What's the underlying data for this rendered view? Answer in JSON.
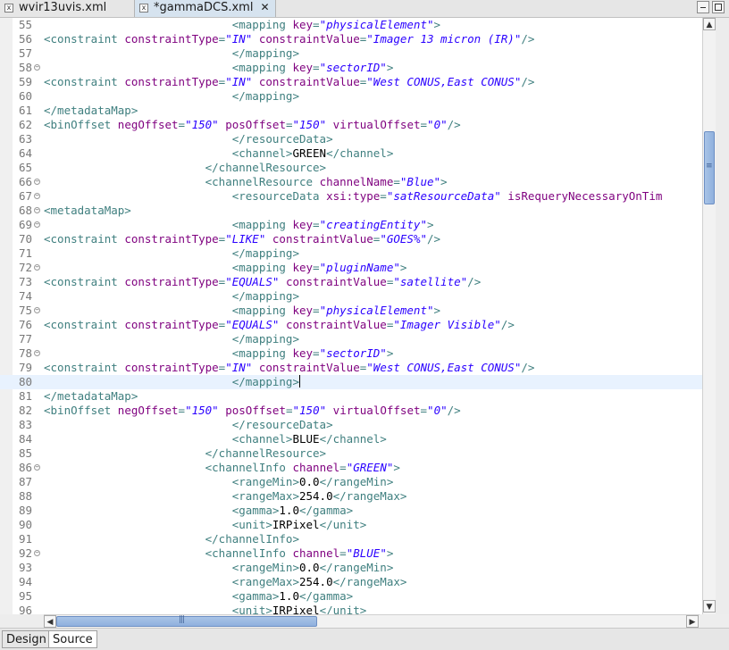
{
  "tabs": [
    {
      "label": "wvir13uvis.xml",
      "active": false
    },
    {
      "label": "*gammaDCS.xml",
      "active": true
    }
  ],
  "bottom_tabs": [
    {
      "label": "Design",
      "active": false
    },
    {
      "label": "Source",
      "active": true
    }
  ],
  "icons": {
    "file": "xml-file-icon",
    "close": "close-icon",
    "minimize": "minimize-icon",
    "maximize": "maximize-icon",
    "fold": "fold-toggle-icon"
  },
  "colors": {
    "tag": "#3f7f7f",
    "attribute": "#7f007f",
    "value": "#2a00ff",
    "text": "#000000",
    "current_line": "#e8f2fe",
    "line_number": "#787878"
  },
  "lines": [
    {
      "n": "55",
      "indent": 28,
      "fold": false,
      "s": [
        [
          "t",
          "<mapping "
        ],
        [
          "a",
          "key"
        ],
        [
          "t",
          "="
        ],
        [
          "v",
          "\"physicalElement\""
        ],
        [
          "t",
          ">"
        ]
      ]
    },
    {
      "n": "56",
      "indent": 0,
      "fold": false,
      "s": [
        [
          "t",
          "<constraint "
        ],
        [
          "a",
          "constraintType"
        ],
        [
          "t",
          "="
        ],
        [
          "v",
          "\"IN\""
        ],
        [
          "t",
          " "
        ],
        [
          "a",
          "constraintValue"
        ],
        [
          "t",
          "="
        ],
        [
          "v",
          "\"Imager 13 micron (IR)\""
        ],
        [
          "t",
          "/>"
        ]
      ]
    },
    {
      "n": "57",
      "indent": 28,
      "fold": false,
      "s": [
        [
          "t",
          "</mapping>"
        ]
      ]
    },
    {
      "n": "58",
      "indent": 28,
      "fold": true,
      "s": [
        [
          "t",
          "<mapping "
        ],
        [
          "a",
          "key"
        ],
        [
          "t",
          "="
        ],
        [
          "v",
          "\"sectorID\""
        ],
        [
          "t",
          ">"
        ]
      ]
    },
    {
      "n": "59",
      "indent": 0,
      "fold": false,
      "s": [
        [
          "t",
          "<constraint "
        ],
        [
          "a",
          "constraintType"
        ],
        [
          "t",
          "="
        ],
        [
          "v",
          "\"IN\""
        ],
        [
          "t",
          " "
        ],
        [
          "a",
          "constraintValue"
        ],
        [
          "t",
          "="
        ],
        [
          "v",
          "\"West CONUS,East CONUS\""
        ],
        [
          "t",
          "/>"
        ]
      ]
    },
    {
      "n": "60",
      "indent": 28,
      "fold": false,
      "s": [
        [
          "t",
          "</mapping>"
        ]
      ]
    },
    {
      "n": "61",
      "indent": 0,
      "fold": false,
      "s": [
        [
          "t",
          "</metadataMap>"
        ]
      ]
    },
    {
      "n": "62",
      "indent": 0,
      "fold": false,
      "s": [
        [
          "t",
          "<binOffset "
        ],
        [
          "a",
          "negOffset"
        ],
        [
          "t",
          "="
        ],
        [
          "v",
          "\"150\""
        ],
        [
          "t",
          " "
        ],
        [
          "a",
          "posOffset"
        ],
        [
          "t",
          "="
        ],
        [
          "v",
          "\"150\""
        ],
        [
          "t",
          " "
        ],
        [
          "a",
          "virtualOffset"
        ],
        [
          "t",
          "="
        ],
        [
          "v",
          "\"0\""
        ],
        [
          "t",
          "/>"
        ]
      ]
    },
    {
      "n": "63",
      "indent": 28,
      "fold": false,
      "s": [
        [
          "t",
          "</resourceData>"
        ]
      ]
    },
    {
      "n": "64",
      "indent": 28,
      "fold": false,
      "s": [
        [
          "t",
          "<channel>"
        ],
        [
          "x",
          "GREEN"
        ],
        [
          "t",
          "</channel>"
        ]
      ]
    },
    {
      "n": "65",
      "indent": 24,
      "fold": false,
      "s": [
        [
          "t",
          "</channelResource>"
        ]
      ]
    },
    {
      "n": "66",
      "indent": 24,
      "fold": true,
      "s": [
        [
          "t",
          "<channelResource "
        ],
        [
          "a",
          "channelName"
        ],
        [
          "t",
          "="
        ],
        [
          "v",
          "\"Blue\""
        ],
        [
          "t",
          ">"
        ]
      ]
    },
    {
      "n": "67",
      "indent": 28,
      "fold": true,
      "s": [
        [
          "t",
          "<resourceData "
        ],
        [
          "a",
          "xsi:type"
        ],
        [
          "t",
          "="
        ],
        [
          "v",
          "\"satResourceData\""
        ],
        [
          "t",
          " "
        ],
        [
          "a",
          "isRequeryNecessaryOnTim"
        ]
      ]
    },
    {
      "n": "68",
      "indent": 0,
      "fold": true,
      "s": [
        [
          "t",
          "<metadataMap>"
        ]
      ]
    },
    {
      "n": "69",
      "indent": 28,
      "fold": true,
      "s": [
        [
          "t",
          "<mapping "
        ],
        [
          "a",
          "key"
        ],
        [
          "t",
          "="
        ],
        [
          "v",
          "\"creatingEntity\""
        ],
        [
          "t",
          ">"
        ]
      ]
    },
    {
      "n": "70",
      "indent": 0,
      "fold": false,
      "s": [
        [
          "t",
          "<constraint "
        ],
        [
          "a",
          "constraintType"
        ],
        [
          "t",
          "="
        ],
        [
          "v",
          "\"LIKE\""
        ],
        [
          "t",
          " "
        ],
        [
          "a",
          "constraintValue"
        ],
        [
          "t",
          "="
        ],
        [
          "v",
          "\"GOES%\""
        ],
        [
          "t",
          "/>"
        ]
      ]
    },
    {
      "n": "71",
      "indent": 28,
      "fold": false,
      "s": [
        [
          "t",
          "</mapping>"
        ]
      ]
    },
    {
      "n": "72",
      "indent": 28,
      "fold": true,
      "s": [
        [
          "t",
          "<mapping "
        ],
        [
          "a",
          "key"
        ],
        [
          "t",
          "="
        ],
        [
          "v",
          "\"pluginName\""
        ],
        [
          "t",
          ">"
        ]
      ]
    },
    {
      "n": "73",
      "indent": 0,
      "fold": false,
      "s": [
        [
          "t",
          "<constraint "
        ],
        [
          "a",
          "constraintType"
        ],
        [
          "t",
          "="
        ],
        [
          "v",
          "\"EQUALS\""
        ],
        [
          "t",
          " "
        ],
        [
          "a",
          "constraintValue"
        ],
        [
          "t",
          "="
        ],
        [
          "v",
          "\"satellite\""
        ],
        [
          "t",
          "/>"
        ]
      ]
    },
    {
      "n": "74",
      "indent": 28,
      "fold": false,
      "s": [
        [
          "t",
          "</mapping>"
        ]
      ]
    },
    {
      "n": "75",
      "indent": 28,
      "fold": true,
      "s": [
        [
          "t",
          "<mapping "
        ],
        [
          "a",
          "key"
        ],
        [
          "t",
          "="
        ],
        [
          "v",
          "\"physicalElement\""
        ],
        [
          "t",
          ">"
        ]
      ]
    },
    {
      "n": "76",
      "indent": 0,
      "fold": false,
      "s": [
        [
          "t",
          "<constraint "
        ],
        [
          "a",
          "constraintType"
        ],
        [
          "t",
          "="
        ],
        [
          "v",
          "\"EQUALS\""
        ],
        [
          "t",
          " "
        ],
        [
          "a",
          "constraintValue"
        ],
        [
          "t",
          "="
        ],
        [
          "v",
          "\"Imager Visible\""
        ],
        [
          "t",
          "/>"
        ]
      ]
    },
    {
      "n": "77",
      "indent": 28,
      "fold": false,
      "s": [
        [
          "t",
          "</mapping>"
        ]
      ]
    },
    {
      "n": "78",
      "indent": 28,
      "fold": true,
      "s": [
        [
          "t",
          "<mapping "
        ],
        [
          "a",
          "key"
        ],
        [
          "t",
          "="
        ],
        [
          "v",
          "\"sectorID\""
        ],
        [
          "t",
          ">"
        ]
      ]
    },
    {
      "n": "79",
      "indent": 0,
      "fold": false,
      "s": [
        [
          "t",
          "<constraint "
        ],
        [
          "a",
          "constraintType"
        ],
        [
          "t",
          "="
        ],
        [
          "v",
          "\"IN\""
        ],
        [
          "t",
          " "
        ],
        [
          "a",
          "constraintValue"
        ],
        [
          "t",
          "="
        ],
        [
          "v",
          "\"West CONUS,East CONUS\""
        ],
        [
          "t",
          "/>"
        ]
      ]
    },
    {
      "n": "80",
      "indent": 28,
      "fold": false,
      "current": true,
      "s": [
        [
          "t",
          "</mapping>"
        ],
        [
          "c",
          ""
        ]
      ]
    },
    {
      "n": "81",
      "indent": 0,
      "fold": false,
      "s": [
        [
          "t",
          "</metadataMap>"
        ]
      ]
    },
    {
      "n": "82",
      "indent": 0,
      "fold": false,
      "s": [
        [
          "t",
          "<binOffset "
        ],
        [
          "a",
          "negOffset"
        ],
        [
          "t",
          "="
        ],
        [
          "v",
          "\"150\""
        ],
        [
          "t",
          " "
        ],
        [
          "a",
          "posOffset"
        ],
        [
          "t",
          "="
        ],
        [
          "v",
          "\"150\""
        ],
        [
          "t",
          " "
        ],
        [
          "a",
          "virtualOffset"
        ],
        [
          "t",
          "="
        ],
        [
          "v",
          "\"0\""
        ],
        [
          "t",
          "/>"
        ]
      ]
    },
    {
      "n": "83",
      "indent": 28,
      "fold": false,
      "s": [
        [
          "t",
          "</resourceData>"
        ]
      ]
    },
    {
      "n": "84",
      "indent": 28,
      "fold": false,
      "s": [
        [
          "t",
          "<channel>"
        ],
        [
          "x",
          "BLUE"
        ],
        [
          "t",
          "</channel>"
        ]
      ]
    },
    {
      "n": "85",
      "indent": 24,
      "fold": false,
      "s": [
        [
          "t",
          "</channelResource>"
        ]
      ]
    },
    {
      "n": "86",
      "indent": 24,
      "fold": true,
      "s": [
        [
          "t",
          "<channelInfo "
        ],
        [
          "a",
          "channel"
        ],
        [
          "t",
          "="
        ],
        [
          "v",
          "\"GREEN\""
        ],
        [
          "t",
          ">"
        ]
      ]
    },
    {
      "n": "87",
      "indent": 28,
      "fold": false,
      "s": [
        [
          "t",
          "<rangeMin>"
        ],
        [
          "x",
          "0.0"
        ],
        [
          "t",
          "</rangeMin>"
        ]
      ]
    },
    {
      "n": "88",
      "indent": 28,
      "fold": false,
      "s": [
        [
          "t",
          "<rangeMax>"
        ],
        [
          "x",
          "254.0"
        ],
        [
          "t",
          "</rangeMax>"
        ]
      ]
    },
    {
      "n": "89",
      "indent": 28,
      "fold": false,
      "s": [
        [
          "t",
          "<gamma>"
        ],
        [
          "x",
          "1.0"
        ],
        [
          "t",
          "</gamma>"
        ]
      ]
    },
    {
      "n": "90",
      "indent": 28,
      "fold": false,
      "s": [
        [
          "t",
          "<unit>"
        ],
        [
          "x",
          "IRPixel"
        ],
        [
          "t",
          "</unit>"
        ]
      ]
    },
    {
      "n": "91",
      "indent": 24,
      "fold": false,
      "s": [
        [
          "t",
          "</channelInfo>"
        ]
      ]
    },
    {
      "n": "92",
      "indent": 24,
      "fold": true,
      "s": [
        [
          "t",
          "<channelInfo "
        ],
        [
          "a",
          "channel"
        ],
        [
          "t",
          "="
        ],
        [
          "v",
          "\"BLUE\""
        ],
        [
          "t",
          ">"
        ]
      ]
    },
    {
      "n": "93",
      "indent": 28,
      "fold": false,
      "s": [
        [
          "t",
          "<rangeMin>"
        ],
        [
          "x",
          "0.0"
        ],
        [
          "t",
          "</rangeMin>"
        ]
      ]
    },
    {
      "n": "94",
      "indent": 28,
      "fold": false,
      "s": [
        [
          "t",
          "<rangeMax>"
        ],
        [
          "x",
          "254.0"
        ],
        [
          "t",
          "</rangeMax>"
        ]
      ]
    },
    {
      "n": "95",
      "indent": 28,
      "fold": false,
      "s": [
        [
          "t",
          "<gamma>"
        ],
        [
          "x",
          "1.0"
        ],
        [
          "t",
          "</gamma>"
        ]
      ]
    },
    {
      "n": "96",
      "indent": 28,
      "fold": false,
      "s": [
        [
          "t",
          "<unit>"
        ],
        [
          "x",
          "IRPixel"
        ],
        [
          "t",
          "</unit>"
        ]
      ]
    }
  ]
}
